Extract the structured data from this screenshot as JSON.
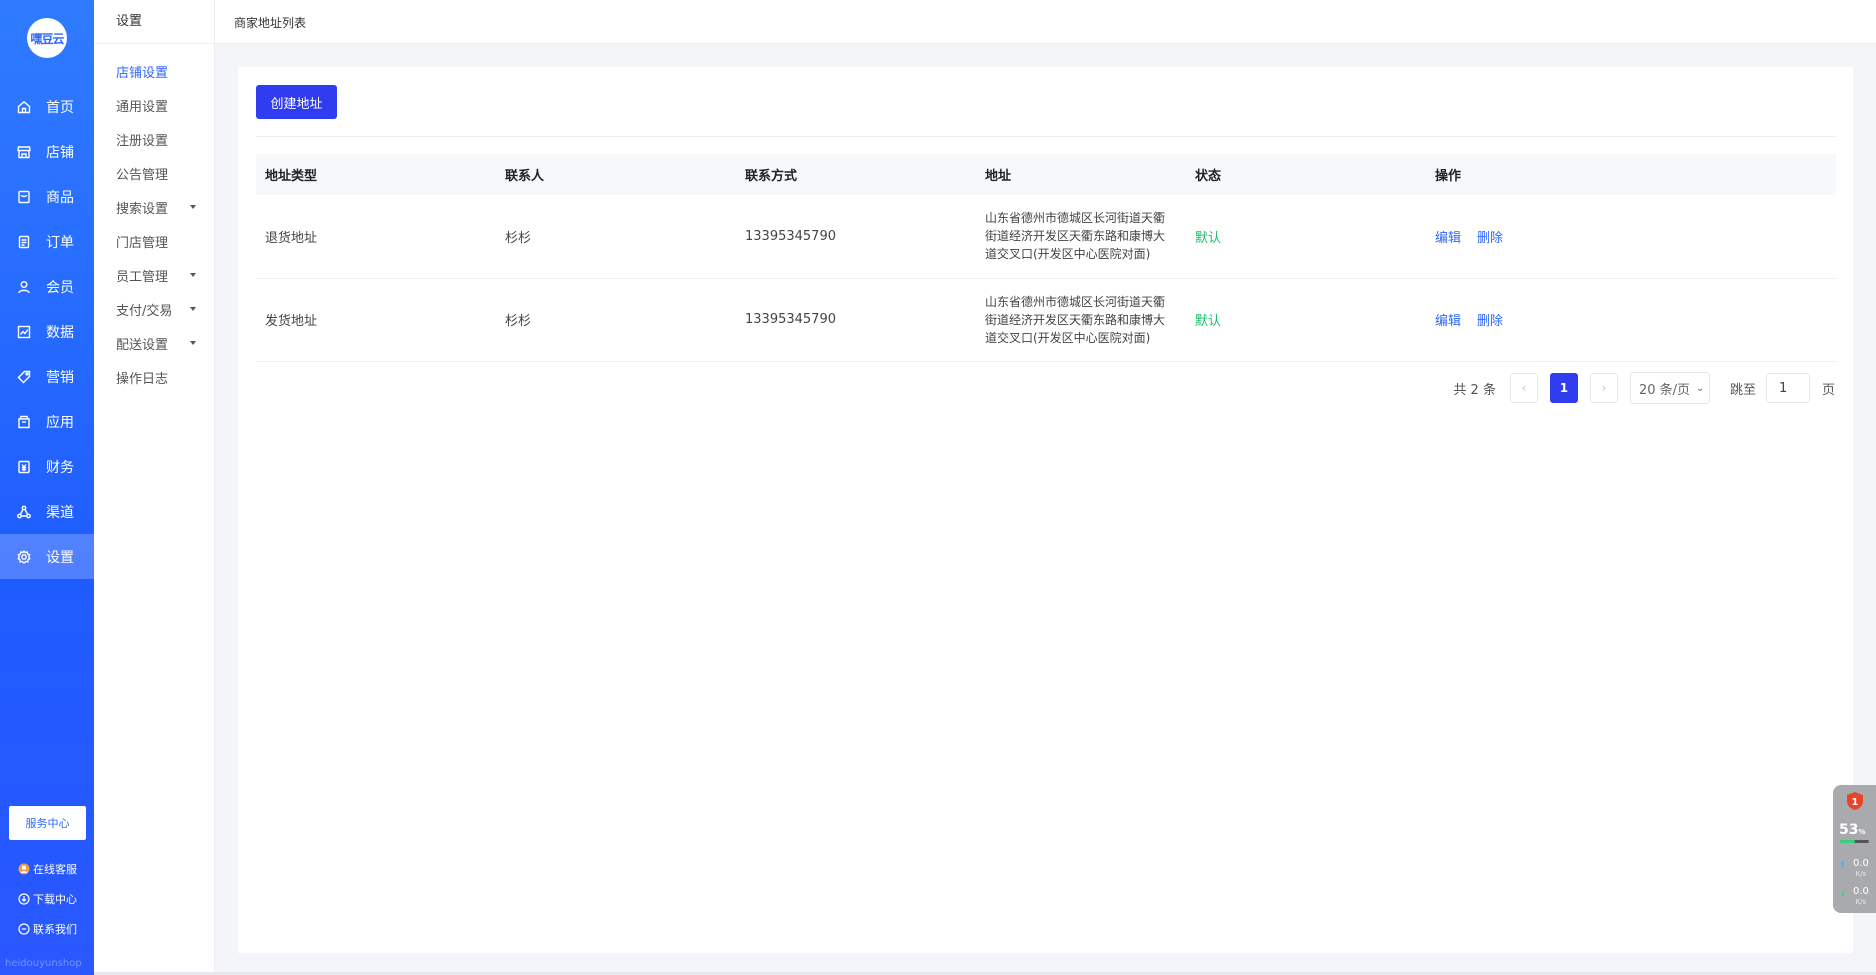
{
  "app": {
    "logo_text": "嘿豆云",
    "watermark": "heidouyunshop"
  },
  "nav": {
    "items": [
      {
        "label": "首页",
        "icon": "home-icon"
      },
      {
        "label": "店铺",
        "icon": "store-icon"
      },
      {
        "label": "商品",
        "icon": "goods-icon"
      },
      {
        "label": "订单",
        "icon": "order-icon"
      },
      {
        "label": "会员",
        "icon": "member-icon"
      },
      {
        "label": "数据",
        "icon": "chart-icon"
      },
      {
        "label": "营销",
        "icon": "tag-icon"
      },
      {
        "label": "应用",
        "icon": "app-box-icon"
      },
      {
        "label": "财务",
        "icon": "finance-icon"
      },
      {
        "label": "渠道",
        "icon": "channel-icon"
      },
      {
        "label": "设置",
        "icon": "gear-icon"
      }
    ],
    "active_index": 10,
    "service_center": "服务中心",
    "side_links": [
      {
        "label": "在线客服",
        "icon": "avatar-icon"
      },
      {
        "label": "下载中心",
        "icon": "download-icon"
      },
      {
        "label": "联系我们",
        "icon": "chat-icon"
      }
    ]
  },
  "subnav": {
    "title": "设置",
    "items": [
      {
        "label": "店铺设置",
        "has_caret": false,
        "active": true
      },
      {
        "label": "通用设置",
        "has_caret": false,
        "active": false
      },
      {
        "label": "注册设置",
        "has_caret": false,
        "active": false
      },
      {
        "label": "公告管理",
        "has_caret": false,
        "active": false
      },
      {
        "label": "搜索设置",
        "has_caret": true,
        "active": false
      },
      {
        "label": "门店管理",
        "has_caret": false,
        "active": false
      },
      {
        "label": "员工管理",
        "has_caret": true,
        "active": false
      },
      {
        "label": "支付/交易",
        "has_caret": true,
        "active": false
      },
      {
        "label": "配送设置",
        "has_caret": true,
        "active": false
      },
      {
        "label": "操作日志",
        "has_caret": false,
        "active": false
      }
    ]
  },
  "header": {
    "breadcrumb": "商家地址列表"
  },
  "main": {
    "create_button": "创建地址",
    "table": {
      "columns": [
        "地址类型",
        "联系人",
        "联系方式",
        "地址",
        "状态",
        "操作"
      ],
      "rows": [
        {
          "type": "退货地址",
          "contact": "杉杉",
          "phone": "13395345790",
          "address": "山东省德州市德城区长河街道天衢街道经济开发区天衢东路和康博大道交叉口(开发区中心医院对面)",
          "status": "默认",
          "actions": [
            "编辑",
            "删除"
          ]
        },
        {
          "type": "发货地址",
          "contact": "杉杉",
          "phone": "13395345790",
          "address": "山东省德州市德城区长河街道天衢街道经济开发区天衢东路和康博大道交叉口(开发区中心医院对面)",
          "status": "默认",
          "actions": [
            "编辑",
            "删除"
          ]
        }
      ]
    },
    "pagination": {
      "total_text": "共 2 条",
      "current_page": "1",
      "page_size": "20 条/页",
      "jump_label": "跳至",
      "jump_value": "1",
      "page_suffix": "页"
    }
  },
  "widget": {
    "alert_count": "1",
    "percent": "53",
    "percent_unit": "%",
    "up_rate": "0.0",
    "down_rate": "0.0",
    "rate_unit": "K/s"
  },
  "colors": {
    "primary": "#2f3cf0",
    "sidebar": "#2f67ff",
    "success": "#19be6b",
    "link": "#2f67ff"
  }
}
